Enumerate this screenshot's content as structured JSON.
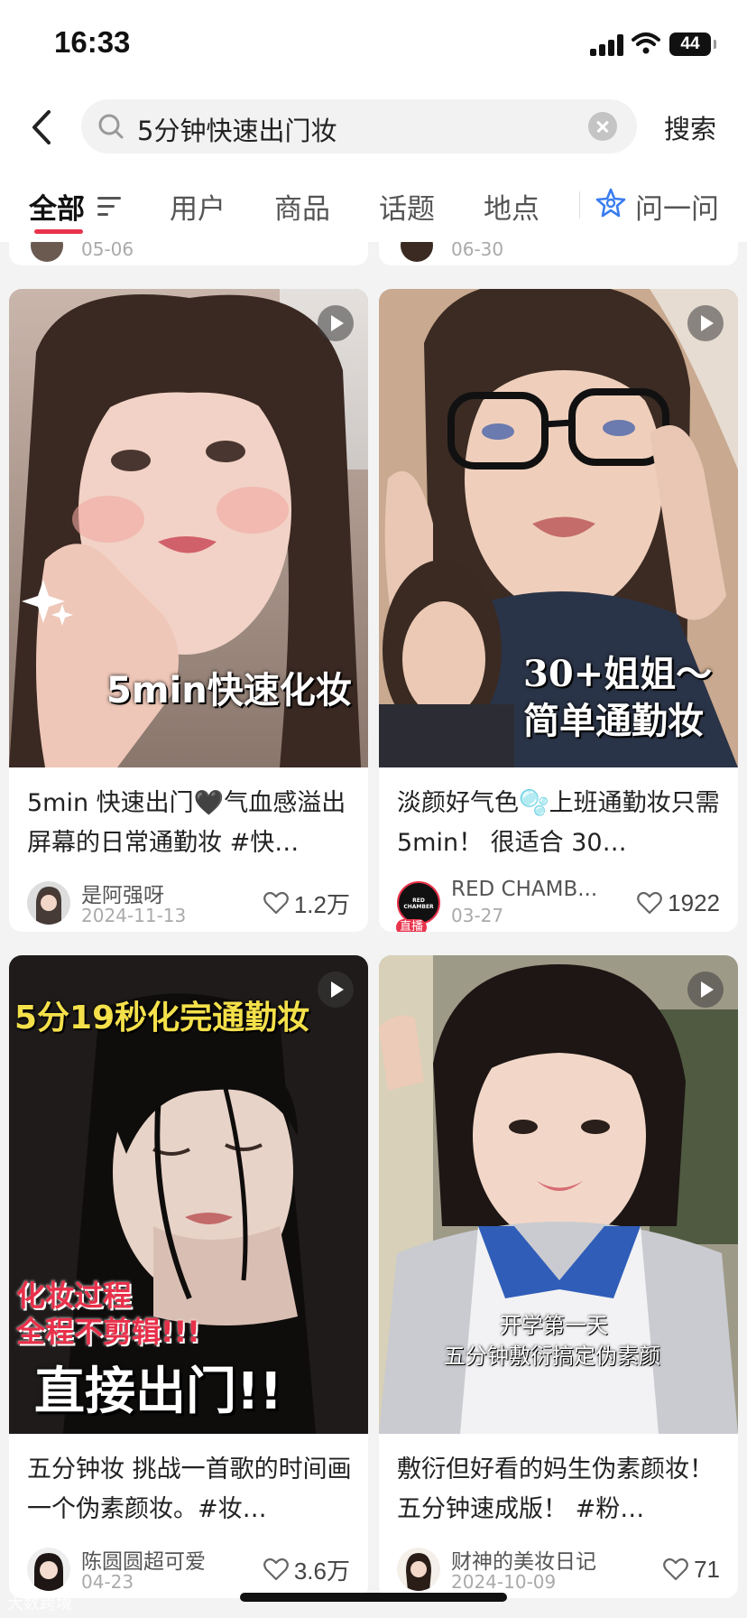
{
  "status_bar": {
    "time": "16:33",
    "battery": "44"
  },
  "search": {
    "query": "5分钟快速出门妆",
    "submit_label": "搜索"
  },
  "tabs": [
    {
      "label": "全部"
    },
    {
      "label": "用户"
    },
    {
      "label": "商品"
    },
    {
      "label": "话题"
    },
    {
      "label": "地点"
    },
    {
      "label": "问一问"
    }
  ],
  "previous_row": {
    "left_date": "05-06",
    "right_date": "06-30"
  },
  "cards": [
    {
      "image_caption": "5min快速化妆",
      "title": "5min 快速出门🖤气血感溢出屏幕的日常通勤妆 #快…",
      "author": "是阿强呀",
      "date": "2024-11-13",
      "likes": "1.2万"
    },
    {
      "image_caption_line1": "30+姐姐～",
      "image_caption_line2": "简单通勤妆",
      "title": "淡颜好气色🫧上班通勤妆只需 5min！ 很适合 30…",
      "author": "RED CHAMB...",
      "avatar_text": "RED CHAMBER",
      "live_badge": "直播",
      "date": "03-27",
      "likes": "1922"
    },
    {
      "image_caption_top": "5分19秒化完通勤妆",
      "image_caption_red1": "化妆过程",
      "image_caption_red2": "全程不剪辑!!!",
      "image_caption_bottom": "直接出门!!",
      "title": "五分钟妆 挑战一首歌的时间画一个伪素颜妆。#妆…",
      "author": "陈圆圆超可爱",
      "date": "04-23",
      "likes": "3.6万"
    },
    {
      "image_caption_line1": "开学第一天",
      "image_caption_line2": "五分钟敷衍搞定伪素颜",
      "title": "敷衍但好看的妈生伪素颜妆！五分钟速成版！ #粉…",
      "author": "财神的美妆日记",
      "date": "2024-10-09",
      "likes": "71"
    }
  ],
  "watermark": "大数跨境",
  "colors": {
    "accent": "#e9334c",
    "ask_icon": "#3b7df0"
  }
}
